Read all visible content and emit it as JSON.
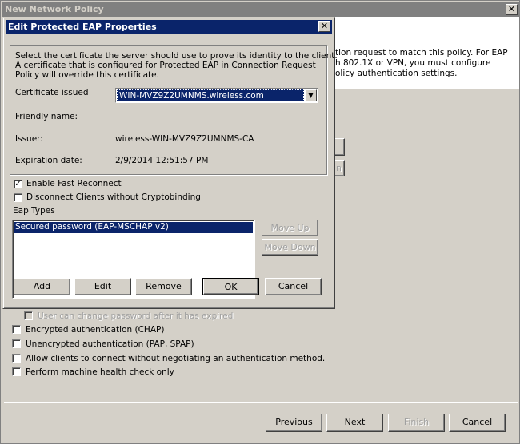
{
  "window": {
    "title": "New Network Policy",
    "close": "✕",
    "description": [
      "tion request to match this policy. For EAP",
      "h 802.1X or VPN, you must configure",
      "olicy authentication settings."
    ],
    "partial_button_2": "n",
    "options": [
      {
        "label": "User can change password after it has expired",
        "checked": false,
        "disabled": true
      },
      {
        "label": "Encrypted authentication (CHAP)",
        "checked": false
      },
      {
        "label": "Unencrypted authentication (PAP, SPAP)",
        "checked": false
      },
      {
        "label": "Allow clients to connect without negotiating an authentication method.",
        "checked": false
      },
      {
        "label": "Perform machine health check only",
        "checked": false
      }
    ],
    "buttons": {
      "previous": "Previous",
      "next": "Next",
      "finish": "Finish",
      "cancel": "Cancel"
    }
  },
  "dialog": {
    "title": "Edit Protected EAP Properties",
    "close": "✕",
    "intro": [
      "Select the certificate the server should use to prove its identity to the client.",
      "A certificate that is configured for Protected EAP in Connection Request",
      "Policy will override this certificate."
    ],
    "certificate_label": "Certificate issued",
    "certificate_value": "WIN-MVZ9Z2UMNMS.wireless.com",
    "friendly_label": "Friendly name:",
    "friendly_value": "",
    "issuer_label": "Issuer:",
    "issuer_value": "wireless-WIN-MVZ9Z2UMNMS-CA",
    "expiration_label": "Expiration date:",
    "expiration_value": "2/9/2014 12:51:57 PM",
    "fast_reconnect": {
      "label": "Enable Fast Reconnect",
      "checked": true
    },
    "cryptobinding": {
      "label": "Disconnect Clients without Cryptobinding",
      "checked": false
    },
    "eap_types_label": "Eap Types",
    "eap_types": [
      "Secured password (EAP-MSCHAP v2)"
    ],
    "buttons": {
      "move_up": "Move Up",
      "move_down": "Move Down",
      "add": "Add",
      "edit": "Edit",
      "remove": "Remove",
      "ok": "OK",
      "cancel": "Cancel"
    }
  }
}
